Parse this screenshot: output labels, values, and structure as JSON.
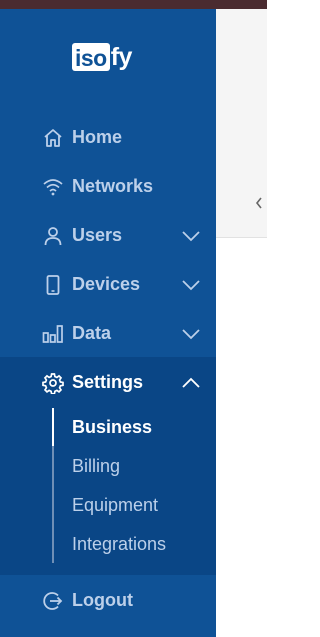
{
  "brand": {
    "logo_box": "iso",
    "logo_rest": "fy"
  },
  "nav": {
    "home": "Home",
    "networks": "Networks",
    "users": "Users",
    "devices": "Devices",
    "data": "Data",
    "settings": "Settings",
    "logout": "Logout"
  },
  "settings_sub": {
    "business": "Business",
    "billing": "Billing",
    "equipment": "Equipment",
    "integrations": "Integrations"
  },
  "icons": {
    "home": "home-icon",
    "networks": "wifi-icon",
    "users": "user-icon",
    "devices": "phone-icon",
    "data": "bar-chart-icon",
    "settings": "gear-icon",
    "logout": "logout-icon",
    "expand": "chevron-down-icon",
    "collapse": "chevron-up-icon",
    "panel_toggle": "chevron-left-icon"
  },
  "colors": {
    "sidebar": "#0f5296",
    "sidebar_active_panel": "#0a4686",
    "text_muted": "#bcd0ea",
    "text_active": "#ffffff",
    "topbar": "#4a2b30"
  }
}
